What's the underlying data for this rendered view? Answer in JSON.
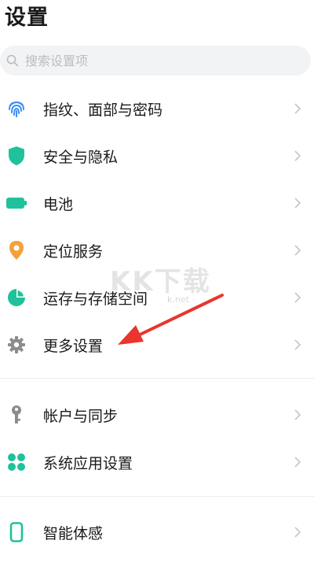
{
  "header": {
    "title": "设置"
  },
  "search": {
    "placeholder": "搜索设置项"
  },
  "items": [
    {
      "label": "指纹、面部与密码",
      "icon": "fingerprint-icon",
      "color": "#3f8ef0"
    },
    {
      "label": "安全与隐私",
      "icon": "shield-icon",
      "color": "#1fc29a"
    },
    {
      "label": "电池",
      "icon": "battery-icon",
      "color": "#1fc29a"
    },
    {
      "label": "定位服务",
      "icon": "location-pin-icon",
      "color": "#f2a23a"
    },
    {
      "label": "运存与存储空间",
      "icon": "pie-chart-icon",
      "color": "#1fc29a"
    },
    {
      "label": "更多设置",
      "icon": "gear-icon",
      "color": "#8c8c8c"
    },
    {
      "label": "帐户与同步",
      "icon": "key-icon",
      "color": "#8c8c8c"
    },
    {
      "label": "系统应用设置",
      "icon": "apps-grid-icon",
      "color": "#1fc29a"
    },
    {
      "label": "智能体感",
      "icon": "phone-icon",
      "color": "#1fc29a"
    }
  ],
  "watermark": {
    "text": "KK下载",
    "sub": "k.net"
  },
  "annotation": {
    "color": "#e8352e"
  }
}
